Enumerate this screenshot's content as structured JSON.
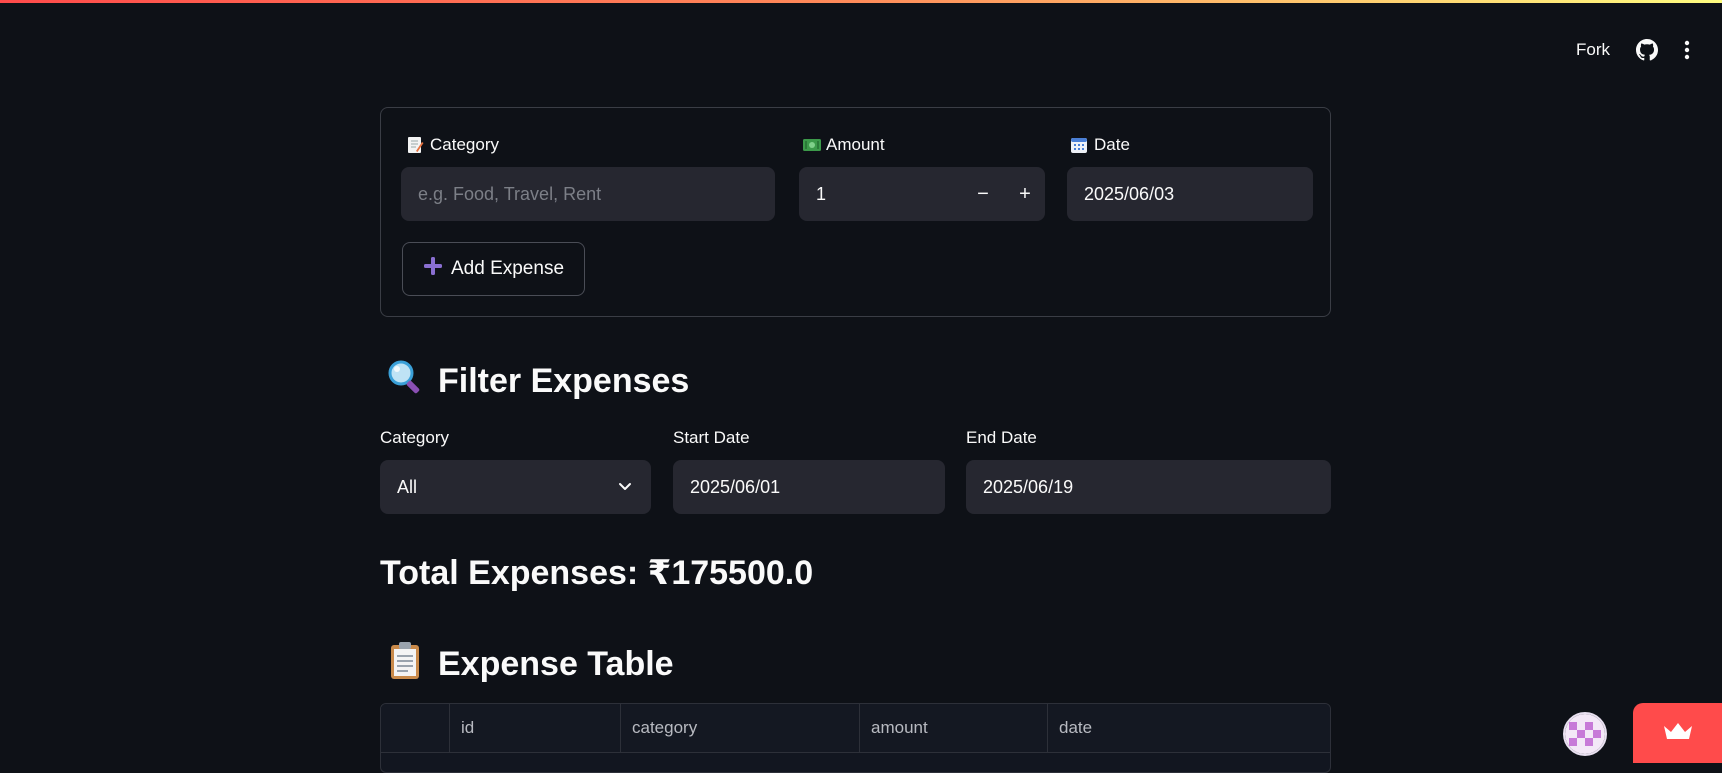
{
  "header": {
    "fork_label": "Fork"
  },
  "add_form": {
    "category_label": "Category",
    "category_placeholder": "e.g. Food, Travel, Rent",
    "amount_label": "Amount",
    "amount_value": "1",
    "amount_decrement": "−",
    "amount_increment": "+",
    "date_label": "Date",
    "date_value": "2025/06/03",
    "add_button_label": "Add Expense"
  },
  "filter": {
    "title": "Filter Expenses",
    "category_label": "Category",
    "category_value": "All",
    "start_date_label": "Start Date",
    "start_date_value": "2025/06/01",
    "end_date_label": "End Date",
    "end_date_value": "2025/06/19"
  },
  "total": {
    "text": "Total Expenses: ₹175500.0"
  },
  "table": {
    "title": "Expense Table",
    "columns": [
      "",
      "id",
      "category",
      "amount",
      "date"
    ]
  },
  "colors": {
    "background": "#0e1117",
    "input_background": "#262730",
    "accent": "#ff4b4b",
    "plus_icon": "#8a6fd1"
  },
  "icons": {
    "category": "memo-icon",
    "amount": "dollar-banknote-icon",
    "date": "calendar-icon",
    "add": "plus-icon",
    "filter": "magnifier-icon",
    "table": "clipboard-icon",
    "github": "github-icon",
    "menu": "kebab-menu-icon",
    "crown": "crown-icon"
  }
}
